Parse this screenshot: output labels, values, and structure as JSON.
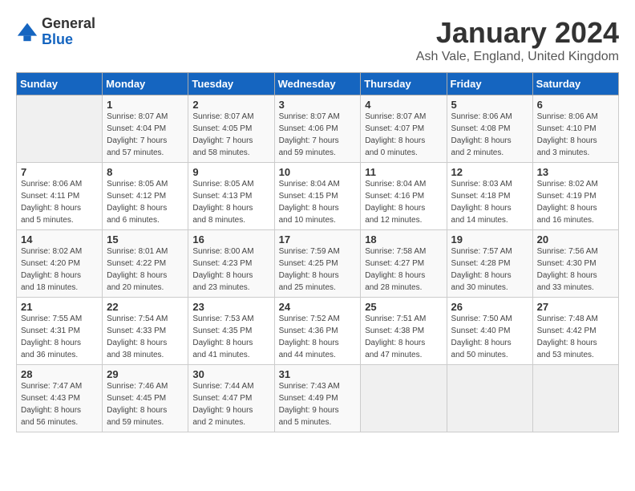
{
  "logo": {
    "line1": "General",
    "line2": "Blue"
  },
  "title": "January 2024",
  "location": "Ash Vale, England, United Kingdom",
  "weekdays": [
    "Sunday",
    "Monday",
    "Tuesday",
    "Wednesday",
    "Thursday",
    "Friday",
    "Saturday"
  ],
  "weeks": [
    [
      {
        "day": "",
        "info": ""
      },
      {
        "day": "1",
        "info": "Sunrise: 8:07 AM\nSunset: 4:04 PM\nDaylight: 7 hours\nand 57 minutes."
      },
      {
        "day": "2",
        "info": "Sunrise: 8:07 AM\nSunset: 4:05 PM\nDaylight: 7 hours\nand 58 minutes."
      },
      {
        "day": "3",
        "info": "Sunrise: 8:07 AM\nSunset: 4:06 PM\nDaylight: 7 hours\nand 59 minutes."
      },
      {
        "day": "4",
        "info": "Sunrise: 8:07 AM\nSunset: 4:07 PM\nDaylight: 8 hours\nand 0 minutes."
      },
      {
        "day": "5",
        "info": "Sunrise: 8:06 AM\nSunset: 4:08 PM\nDaylight: 8 hours\nand 2 minutes."
      },
      {
        "day": "6",
        "info": "Sunrise: 8:06 AM\nSunset: 4:10 PM\nDaylight: 8 hours\nand 3 minutes."
      }
    ],
    [
      {
        "day": "7",
        "info": "Sunrise: 8:06 AM\nSunset: 4:11 PM\nDaylight: 8 hours\nand 5 minutes."
      },
      {
        "day": "8",
        "info": "Sunrise: 8:05 AM\nSunset: 4:12 PM\nDaylight: 8 hours\nand 6 minutes."
      },
      {
        "day": "9",
        "info": "Sunrise: 8:05 AM\nSunset: 4:13 PM\nDaylight: 8 hours\nand 8 minutes."
      },
      {
        "day": "10",
        "info": "Sunrise: 8:04 AM\nSunset: 4:15 PM\nDaylight: 8 hours\nand 10 minutes."
      },
      {
        "day": "11",
        "info": "Sunrise: 8:04 AM\nSunset: 4:16 PM\nDaylight: 8 hours\nand 12 minutes."
      },
      {
        "day": "12",
        "info": "Sunrise: 8:03 AM\nSunset: 4:18 PM\nDaylight: 8 hours\nand 14 minutes."
      },
      {
        "day": "13",
        "info": "Sunrise: 8:02 AM\nSunset: 4:19 PM\nDaylight: 8 hours\nand 16 minutes."
      }
    ],
    [
      {
        "day": "14",
        "info": "Sunrise: 8:02 AM\nSunset: 4:20 PM\nDaylight: 8 hours\nand 18 minutes."
      },
      {
        "day": "15",
        "info": "Sunrise: 8:01 AM\nSunset: 4:22 PM\nDaylight: 8 hours\nand 20 minutes."
      },
      {
        "day": "16",
        "info": "Sunrise: 8:00 AM\nSunset: 4:23 PM\nDaylight: 8 hours\nand 23 minutes."
      },
      {
        "day": "17",
        "info": "Sunrise: 7:59 AM\nSunset: 4:25 PM\nDaylight: 8 hours\nand 25 minutes."
      },
      {
        "day": "18",
        "info": "Sunrise: 7:58 AM\nSunset: 4:27 PM\nDaylight: 8 hours\nand 28 minutes."
      },
      {
        "day": "19",
        "info": "Sunrise: 7:57 AM\nSunset: 4:28 PM\nDaylight: 8 hours\nand 30 minutes."
      },
      {
        "day": "20",
        "info": "Sunrise: 7:56 AM\nSunset: 4:30 PM\nDaylight: 8 hours\nand 33 minutes."
      }
    ],
    [
      {
        "day": "21",
        "info": "Sunrise: 7:55 AM\nSunset: 4:31 PM\nDaylight: 8 hours\nand 36 minutes."
      },
      {
        "day": "22",
        "info": "Sunrise: 7:54 AM\nSunset: 4:33 PM\nDaylight: 8 hours\nand 38 minutes."
      },
      {
        "day": "23",
        "info": "Sunrise: 7:53 AM\nSunset: 4:35 PM\nDaylight: 8 hours\nand 41 minutes."
      },
      {
        "day": "24",
        "info": "Sunrise: 7:52 AM\nSunset: 4:36 PM\nDaylight: 8 hours\nand 44 minutes."
      },
      {
        "day": "25",
        "info": "Sunrise: 7:51 AM\nSunset: 4:38 PM\nDaylight: 8 hours\nand 47 minutes."
      },
      {
        "day": "26",
        "info": "Sunrise: 7:50 AM\nSunset: 4:40 PM\nDaylight: 8 hours\nand 50 minutes."
      },
      {
        "day": "27",
        "info": "Sunrise: 7:48 AM\nSunset: 4:42 PM\nDaylight: 8 hours\nand 53 minutes."
      }
    ],
    [
      {
        "day": "28",
        "info": "Sunrise: 7:47 AM\nSunset: 4:43 PM\nDaylight: 8 hours\nand 56 minutes."
      },
      {
        "day": "29",
        "info": "Sunrise: 7:46 AM\nSunset: 4:45 PM\nDaylight: 8 hours\nand 59 minutes."
      },
      {
        "day": "30",
        "info": "Sunrise: 7:44 AM\nSunset: 4:47 PM\nDaylight: 9 hours\nand 2 minutes."
      },
      {
        "day": "31",
        "info": "Sunrise: 7:43 AM\nSunset: 4:49 PM\nDaylight: 9 hours\nand 5 minutes."
      },
      {
        "day": "",
        "info": ""
      },
      {
        "day": "",
        "info": ""
      },
      {
        "day": "",
        "info": ""
      }
    ]
  ]
}
